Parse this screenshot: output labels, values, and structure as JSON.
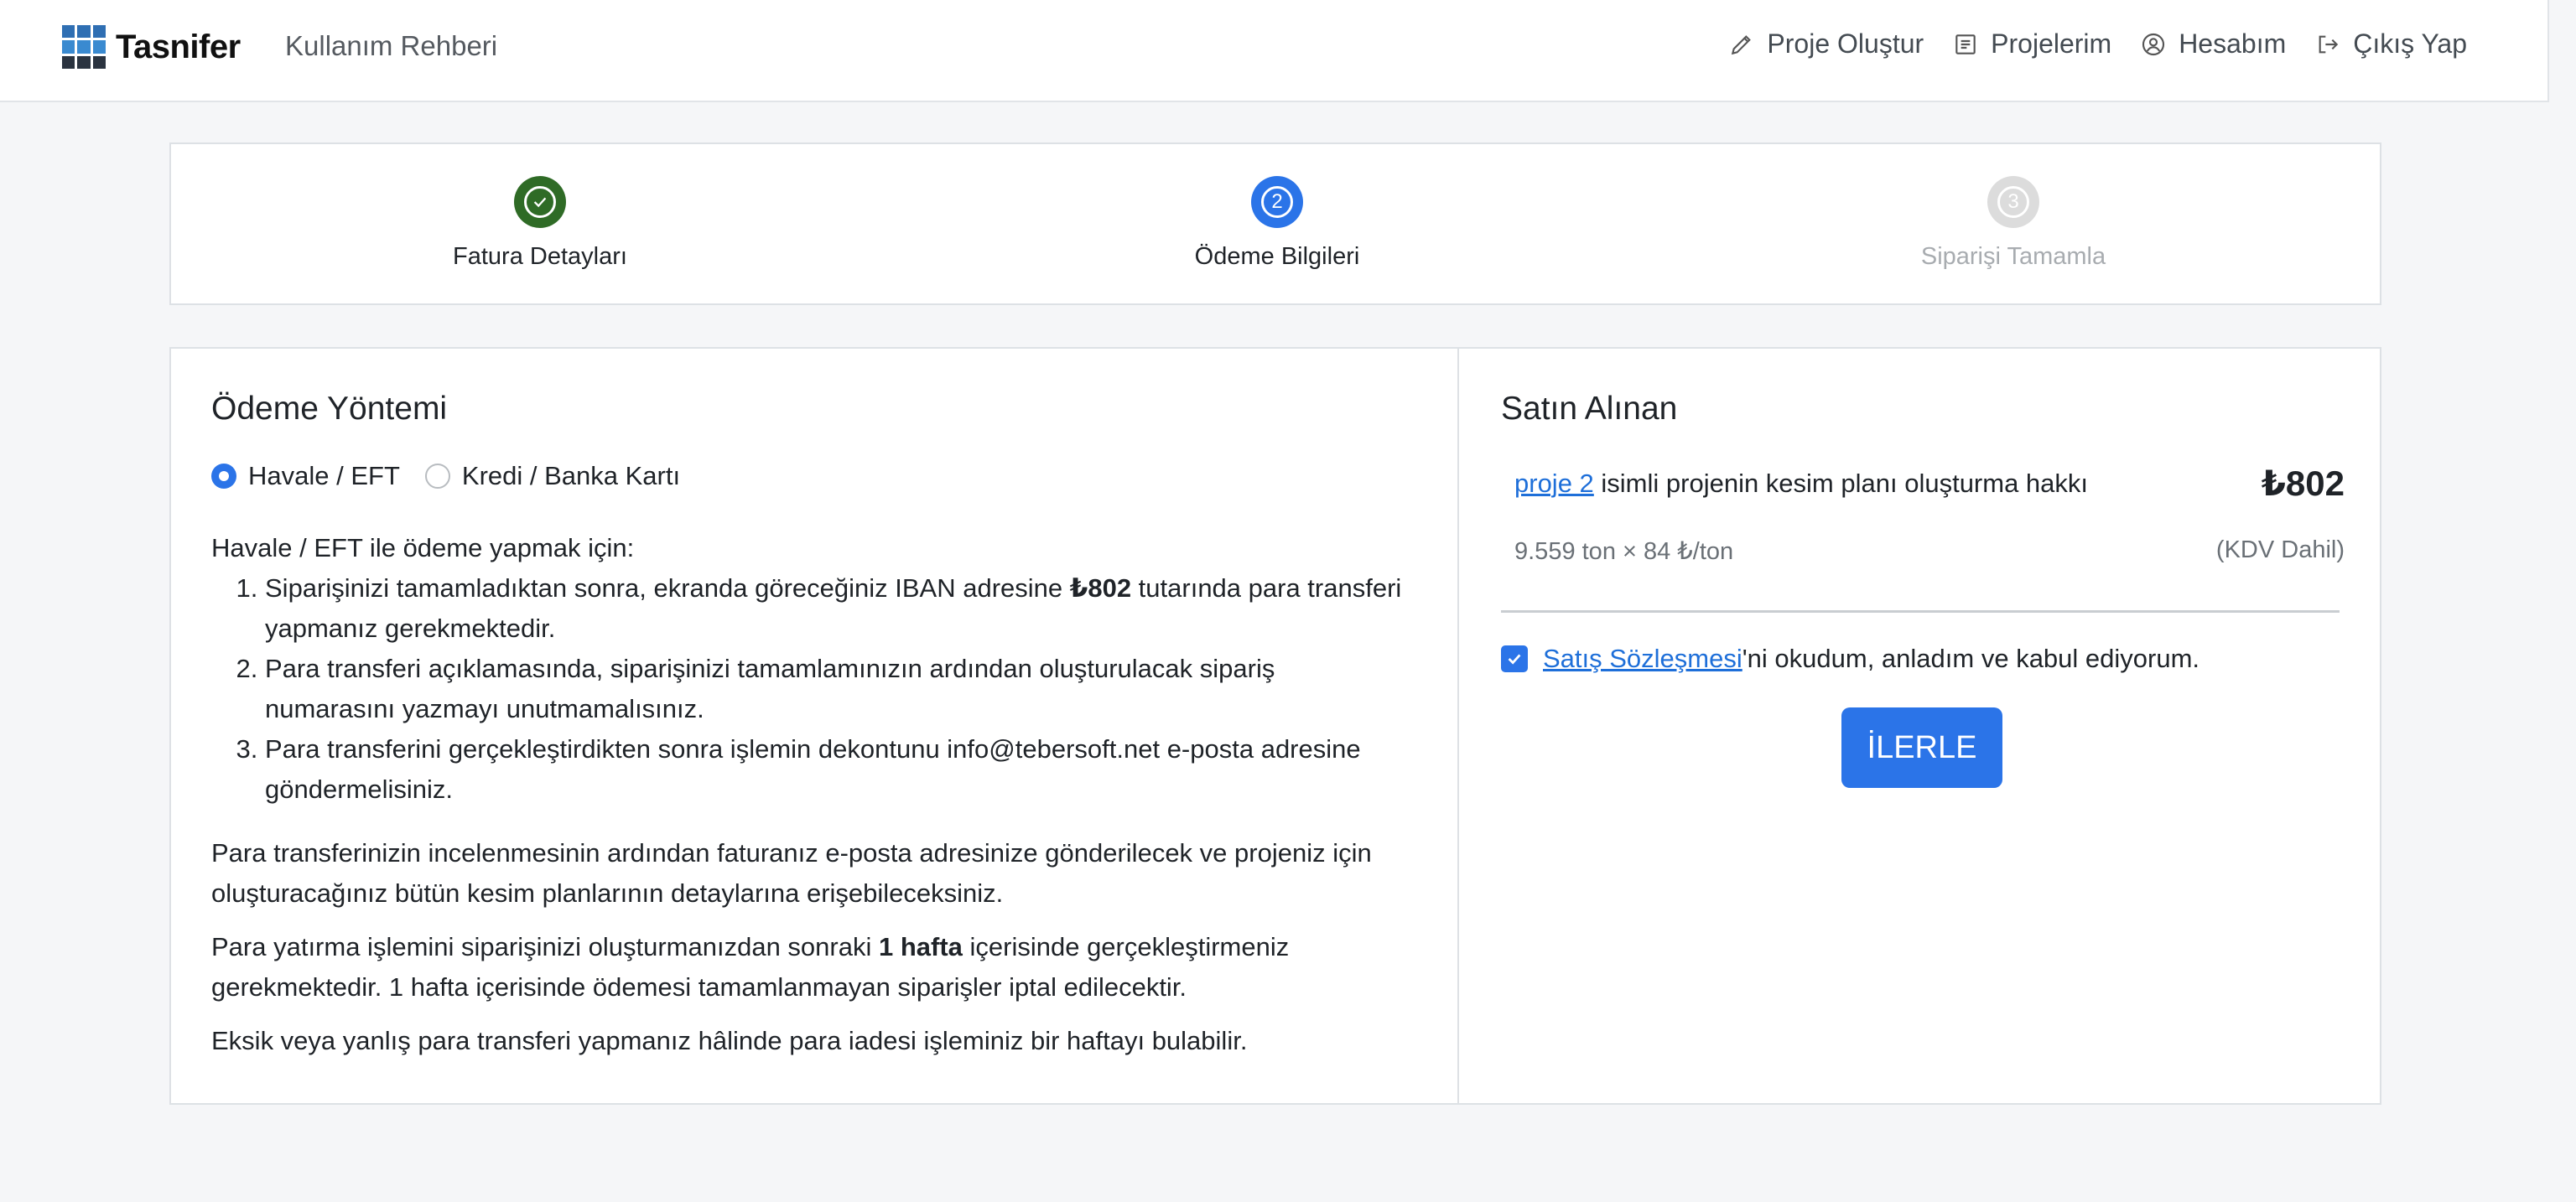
{
  "header": {
    "brand": "Tasnifer",
    "guide": "Kullanım Rehberi",
    "nav": [
      {
        "label": "Proje Oluştur",
        "icon": "pencil-icon"
      },
      {
        "label": "Projelerim",
        "icon": "list-icon"
      },
      {
        "label": "Hesabım",
        "icon": "user-icon"
      },
      {
        "label": "Çıkış Yap",
        "icon": "logout-icon"
      }
    ]
  },
  "stepper": {
    "steps": [
      {
        "label": "Fatura Detayları",
        "state": "done"
      },
      {
        "label": "Ödeme Bilgileri",
        "state": "active",
        "number": "2"
      },
      {
        "label": "Siparişi Tamamla",
        "state": "pending",
        "number": "3"
      }
    ]
  },
  "payment": {
    "title": "Ödeme Yöntemi",
    "options": [
      {
        "label": "Havale / EFT",
        "checked": true
      },
      {
        "label": "Kredi / Banka Kartı",
        "checked": false
      }
    ],
    "intro": "Havale / EFT ile ödeme yapmak için:",
    "step1_a": "Siparişinizi tamamladıktan sonra, ekranda göreceğiniz IBAN adresine ",
    "step1_amount": "₺802",
    "step1_b": " tutarında para transferi yapmanız gerekmektedir.",
    "step2": "Para transferi açıklamasında, siparişinizi tamamlamınızın ardından oluşturulacak sipariş numarasını yazmayı unutmamalısınız.",
    "step3": "Para transferini gerçekleştirdikten sonra işlemin dekontunu info@tebersoft.net e-posta adresine göndermelisiniz.",
    "para1": "Para transferinizin incelenmesinin ardından faturanız e-posta adresinize gönderilecek ve projeniz için oluşturacağınız bütün kesim planlarının detaylarına erişebileceksiniz.",
    "para2_a": "Para yatırma işlemini siparişinizi oluşturmanızdan sonraki ",
    "para2_bold": "1 hafta",
    "para2_b": " içerisinde gerçekleştirmeniz gerekmektedir. 1 hafta içerisinde ödemesi tamamlanmayan siparişler iptal edilecektir.",
    "para3": "Eksik veya yanlış para transferi yapmanız hâlinde para iadesi işleminiz bir haftayı bulabilir."
  },
  "summary": {
    "title": "Satın Alınan",
    "project_link": "proje 2",
    "description": " isimli projenin kesim planı oluşturma hakkı",
    "price": "₺802",
    "calc": "9.559 ton × 84 ₺/ton",
    "vat": "(KDV Dahil)",
    "agreement_link": "Satış Sözleşmesi",
    "agreement_text": "'ni okudum, anladım ve kabul ediyorum.",
    "agreement_checked": true,
    "next_button": "İLERLE"
  },
  "colors": {
    "accent": "#2b74e8",
    "done": "#2f6b26",
    "pending": "#dcdcdc"
  }
}
